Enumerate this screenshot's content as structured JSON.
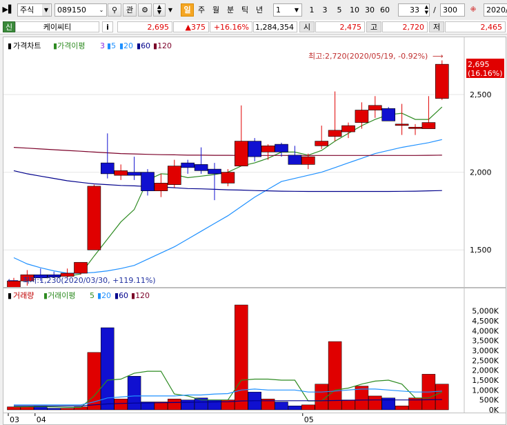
{
  "toolbar": {
    "market_select": "주식",
    "code_input": "089150",
    "watch_button": "관",
    "period_active": "일",
    "periods": [
      "주",
      "월",
      "분",
      "틱",
      "년"
    ],
    "interval_select": "1",
    "interval_buttons": [
      "1",
      "3",
      "5",
      "10",
      "30",
      "60"
    ],
    "zoom_value": "33",
    "slash": "/",
    "total_value": "300",
    "date_value": "2020/"
  },
  "info": {
    "badge": "신",
    "name": "케이씨티",
    "info_button": "i",
    "price": "2,695",
    "change": "▲375",
    "change_pct": "+16.16%",
    "volume": "1,284,354",
    "open_label": "시",
    "open": "2,475",
    "high_label": "고",
    "high": "2,720",
    "low_label": "저",
    "low": "2,465"
  },
  "price_legend": {
    "title": "가격차트",
    "ma_label": "가격이평",
    "ma_values": [
      "3",
      "5",
      "20",
      "60",
      "120"
    ]
  },
  "volume_legend": {
    "title": "거래량",
    "ma_label": "거래이평",
    "ma_values": [
      "5",
      "20",
      "60",
      "120"
    ]
  },
  "annotations": {
    "high": "최고:2,720(2020/05/19, -0.92%)",
    "low": "최저:1,230(2020/03/30, +119.11%)",
    "current_price": "2,695",
    "current_pct": "(16.16%)"
  },
  "colors": {
    "up": "#e00000",
    "down": "#1010d0",
    "ma3": "#8a2be2",
    "ma5": "#2e8b22",
    "ma20": "#1e90ff",
    "ma60": "#00008b",
    "ma120": "#7b0028"
  },
  "chart_data": [
    {
      "type": "candlestick",
      "x_labels": [
        "03",
        "04",
        "05"
      ],
      "y_ticks": [
        "2,500",
        "2,000",
        "1,500"
      ],
      "ylim": [
        1270,
        2780
      ],
      "candles": [
        {
          "o": 1230,
          "h": 1320,
          "l": 1220,
          "c": 1300
        },
        {
          "o": 1300,
          "h": 1370,
          "l": 1270,
          "c": 1340
        },
        {
          "o": 1340,
          "h": 1380,
          "l": 1300,
          "c": 1320
        },
        {
          "o": 1340,
          "h": 1360,
          "l": 1320,
          "c": 1325
        },
        {
          "o": 1330,
          "h": 1380,
          "l": 1320,
          "c": 1350
        },
        {
          "o": 1350,
          "h": 1420,
          "l": 1340,
          "c": 1420
        },
        {
          "o": 1500,
          "h": 1920,
          "l": 1500,
          "c": 1910
        },
        {
          "o": 2060,
          "h": 2250,
          "l": 1960,
          "c": 1990
        },
        {
          "o": 1980,
          "h": 2050,
          "l": 1950,
          "c": 2010
        },
        {
          "o": 2000,
          "h": 2100,
          "l": 1950,
          "c": 1980
        },
        {
          "o": 2000,
          "h": 2020,
          "l": 1850,
          "c": 1880
        },
        {
          "o": 1880,
          "h": 1990,
          "l": 1840,
          "c": 1930
        },
        {
          "o": 1920,
          "h": 2080,
          "l": 1900,
          "c": 2040
        },
        {
          "o": 2060,
          "h": 2080,
          "l": 1990,
          "c": 2030
        },
        {
          "o": 2050,
          "h": 2160,
          "l": 1990,
          "c": 2010
        },
        {
          "o": 2020,
          "h": 2060,
          "l": 1820,
          "c": 1990
        },
        {
          "o": 1930,
          "h": 2020,
          "l": 1910,
          "c": 2000
        },
        {
          "o": 2040,
          "h": 2430,
          "l": 2040,
          "c": 2200
        },
        {
          "o": 2200,
          "h": 2220,
          "l": 2070,
          "c": 2100
        },
        {
          "o": 2130,
          "h": 2180,
          "l": 2080,
          "c": 2170
        },
        {
          "o": 2180,
          "h": 2190,
          "l": 2100,
          "c": 2130
        },
        {
          "o": 2110,
          "h": 2170,
          "l": 2050,
          "c": 2050
        },
        {
          "o": 2050,
          "h": 2120,
          "l": 2020,
          "c": 2100
        },
        {
          "o": 2170,
          "h": 2300,
          "l": 2150,
          "c": 2200
        },
        {
          "o": 2230,
          "h": 2520,
          "l": 2200,
          "c": 2270
        },
        {
          "o": 2260,
          "h": 2320,
          "l": 2220,
          "c": 2300
        },
        {
          "o": 2320,
          "h": 2450,
          "l": 2280,
          "c": 2400
        },
        {
          "o": 2400,
          "h": 2490,
          "l": 2350,
          "c": 2430
        },
        {
          "o": 2410,
          "h": 2420,
          "l": 2330,
          "c": 2330
        },
        {
          "o": 2310,
          "h": 2440,
          "l": 2240,
          "c": 2310
        },
        {
          "o": 2290,
          "h": 2310,
          "l": 2240,
          "c": 2290
        },
        {
          "o": 2280,
          "h": 2490,
          "l": 2280,
          "c": 2320
        },
        {
          "o": 2475,
          "h": 2720,
          "l": 2465,
          "c": 2695
        }
      ],
      "ma_series": [
        {
          "name": "5",
          "values": [
            null,
            null,
            null,
            null,
            1330,
            1345,
            1460,
            1570,
            1680,
            1760,
            1950,
            1990,
            1985,
            1965,
            1975,
            1985,
            2000,
            2040,
            2060,
            2090,
            2130,
            2130,
            2110,
            2140,
            2200,
            2250,
            2300,
            2340,
            2370,
            2380,
            2340,
            2340,
            2420
          ]
        },
        {
          "name": "20",
          "values": [
            1450,
            1410,
            1385,
            1365,
            1350,
            1350,
            1355,
            1365,
            1380,
            1400,
            1440,
            1480,
            1520,
            1570,
            1620,
            1670,
            1720,
            1780,
            1840,
            1890,
            1940,
            1960,
            1980,
            2000,
            2030,
            2060,
            2090,
            2120,
            2140,
            2160,
            2175,
            2190,
            2210
          ]
        },
        {
          "name": "60",
          "values": [
            2010,
            1990,
            1975,
            1960,
            1945,
            1935,
            1925,
            1920,
            1915,
            1912,
            1908,
            1905,
            1900,
            1895,
            1893,
            1890,
            1887,
            1885,
            1882,
            1880,
            1878,
            1877,
            1876,
            1876,
            1876,
            1876,
            1876,
            1876,
            1876,
            1877,
            1878,
            1880,
            1882
          ]
        },
        {
          "name": "120",
          "values": [
            2160,
            2155,
            2150,
            2145,
            2140,
            2135,
            2130,
            2125,
            2120,
            2118,
            2115,
            2113,
            2112,
            2110,
            2110,
            2109,
            2109,
            2108,
            2108,
            2108,
            2108,
            2108,
            2108,
            2108,
            2108,
            2108,
            2108,
            2108,
            2108,
            2108,
            2108,
            2109,
            2110
          ]
        }
      ]
    },
    {
      "type": "bar",
      "y_ticks": [
        "5,000K",
        "4,500K",
        "4,000K",
        "3,500K",
        "3,000K",
        "2,500K",
        "2,000K",
        "1,500K",
        "1,000K",
        "500K",
        "0K"
      ],
      "ylim": [
        0,
        5300
      ],
      "values": [
        150,
        150,
        200,
        80,
        80,
        150,
        2900,
        4150,
        550,
        1700,
        400,
        400,
        550,
        500,
        600,
        500,
        500,
        5300,
        900,
        550,
        400,
        200,
        250,
        1300,
        3450,
        500,
        1200,
        700,
        600,
        200,
        600,
        1800,
        1300
      ],
      "ma_series": [
        {
          "name": "5",
          "values": [
            150,
            150,
            160,
            150,
            130,
            120,
            700,
            1500,
            1550,
            1850,
            1950,
            1950,
            800,
            700,
            500,
            500,
            500,
            1500,
            1550,
            1550,
            1500,
            1500,
            450,
            450,
            1000,
            1100,
            1300,
            1450,
            1500,
            1300,
            600,
            600,
            900
          ]
        },
        {
          "name": "20",
          "values": [
            250,
            250,
            250,
            250,
            250,
            250,
            400,
            600,
            650,
            700,
            700,
            700,
            700,
            750,
            750,
            800,
            820,
            1000,
            1050,
            1000,
            1000,
            1000,
            900,
            900,
            950,
            1000,
            1050,
            1050,
            1000,
            950,
            900,
            900,
            950
          ]
        },
        {
          "name": "60",
          "values": [
            200,
            200,
            200,
            200,
            200,
            200,
            250,
            300,
            320,
            340,
            350,
            360,
            370,
            380,
            390,
            400,
            410,
            450,
            460,
            460,
            460,
            460,
            460,
            460,
            470,
            480,
            490,
            500,
            500,
            500,
            500,
            510,
            520
          ]
        }
      ]
    }
  ]
}
